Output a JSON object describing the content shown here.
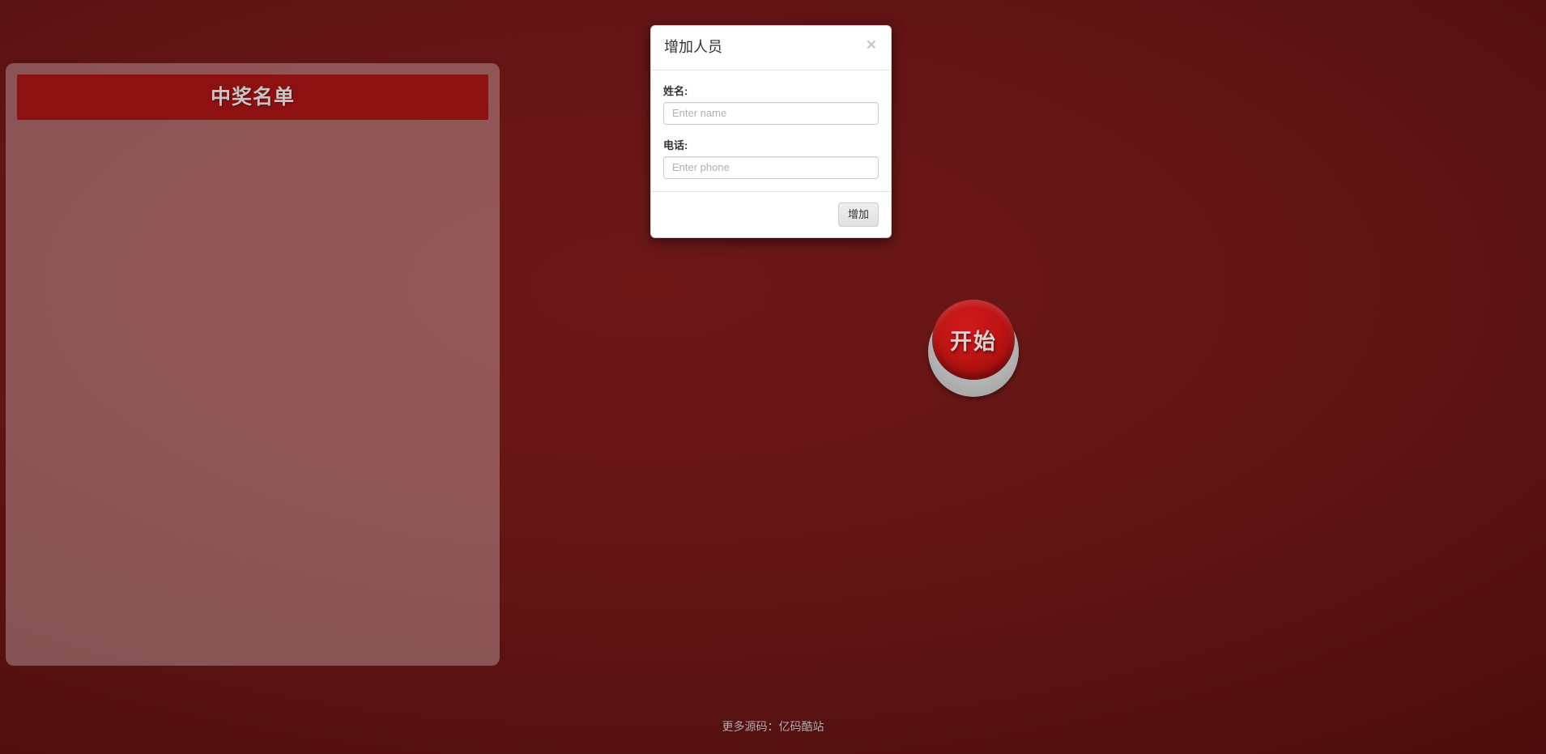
{
  "theme": {
    "background_color": "#5d1212",
    "accent_red": "#8e1111",
    "panel_overlay": "rgba(255,255,255,0.28)",
    "button_red": "#bd1414",
    "silver_text": "#c9c4c4"
  },
  "winner_panel": {
    "heading": "中奖名单",
    "items": []
  },
  "start_button": {
    "label": "开始"
  },
  "modal": {
    "title": "增加人员",
    "close_icon": "×",
    "fields": [
      {
        "label": "姓名:",
        "placeholder": "Enter name",
        "value": "",
        "name": "name"
      },
      {
        "label": "电话:",
        "placeholder": "Enter phone",
        "value": "",
        "name": "phone"
      }
    ],
    "submit_label": "增加"
  },
  "footer": {
    "prefix": "更多源码：",
    "link_text": "亿码酷站"
  }
}
